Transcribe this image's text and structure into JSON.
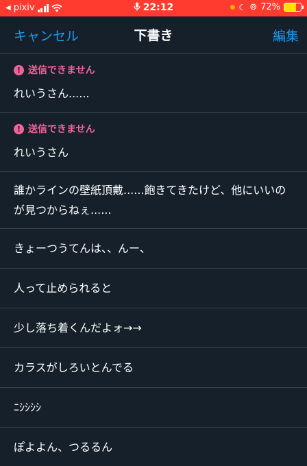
{
  "status": {
    "carrier": "pixiv",
    "time": "22:12",
    "battery": "72%",
    "battery_level": 0.72
  },
  "nav": {
    "cancel": "キャンセル",
    "title": "下書き",
    "edit": "編集"
  },
  "drafts": [
    {
      "error": "送信できません",
      "text": "れいうさん......"
    },
    {
      "error": "送信できません",
      "text": "れいうさん"
    },
    {
      "text": "誰かラインの壁紙頂戴......飽きてきたけど、他にいいのが見つからねぇ......"
    },
    {
      "text": "きょーつうてんは、、んー、"
    },
    {
      "text": "人って止められると"
    },
    {
      "text": "少し落ち着くんだよォ→→"
    },
    {
      "text": "カラスがしろいとんでる"
    },
    {
      "text": "ﾆｼｼｼｼ"
    },
    {
      "text": "ぽよよん、つるるん"
    }
  ],
  "colors": {
    "background": "#15202b",
    "accent": "#1d9bf0",
    "error": "#f4629a",
    "statusbar": "#ff3b30"
  }
}
